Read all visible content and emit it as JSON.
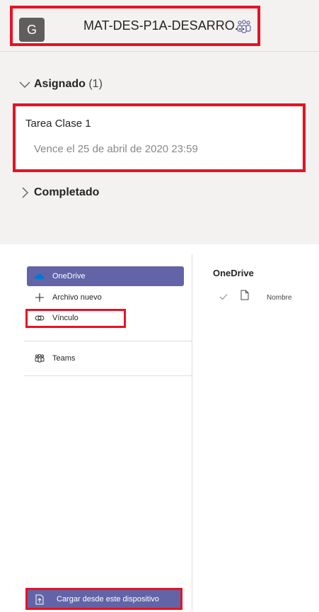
{
  "header": {
    "avatar_letter": "G",
    "team_name": "MAT-DES-P1A-DESARRO...",
    "team_icon": "teams-icon"
  },
  "assignments": {
    "assigned_label": "Asignado",
    "assigned_count": "(1)",
    "task_title": "Tarea Clase 1",
    "task_due": "Vence el 25 de abril de 2020 23:59",
    "completed_label": "Completado"
  },
  "file_picker": {
    "nav": [
      {
        "label": "OneDrive",
        "icon": "onedrive-icon",
        "selected": true
      },
      {
        "label": "Archivo nuevo",
        "icon": "plus-icon"
      },
      {
        "label": "Vínculo",
        "icon": "link-icon"
      },
      {
        "label": "Teams",
        "icon": "teams-icon"
      }
    ],
    "upload_label": "Cargar desde este dispositivo",
    "content_title": "OneDrive",
    "column_name": "Nombre"
  },
  "colors": {
    "accent": "#6264a7",
    "highlight": "#e81123",
    "panel_bg": "#f3f2f1"
  }
}
